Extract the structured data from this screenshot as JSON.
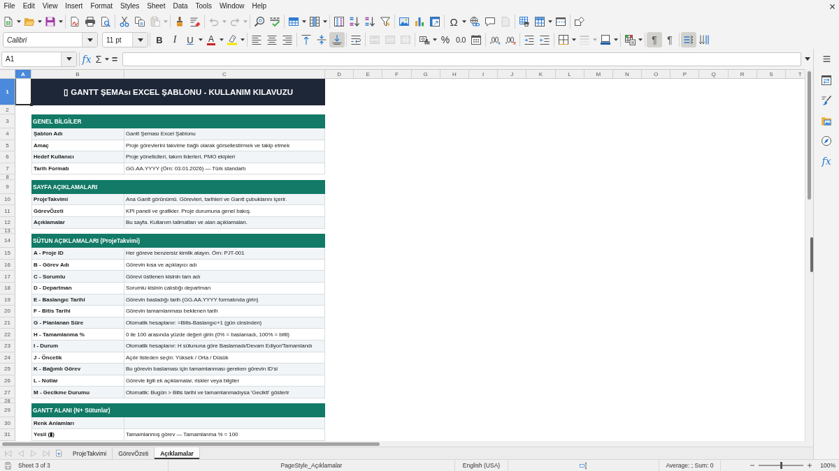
{
  "menu_bar": {
    "items": [
      "File",
      "Edit",
      "View",
      "Insert",
      "Format",
      "Styles",
      "Sheet",
      "Data",
      "Tools",
      "Window",
      "Help"
    ]
  },
  "standard_toolbar": {
    "buttons": [
      {
        "kind": "icon",
        "disabled": false
      },
      {
        "kind": "icon",
        "disabled": false
      },
      {
        "kind": "icon",
        "disabled": false
      },
      {
        "kind": "icon",
        "disabled": false
      },
      {
        "kind": "icon",
        "disabled": false
      },
      {
        "kind": "icon",
        "disabled": false
      },
      {
        "kind": "icon",
        "disabled": false
      },
      {
        "kind": "icon",
        "disabled": false
      },
      {
        "kind": "icon",
        "disabled": true
      },
      {
        "kind": "icon",
        "disabled": false
      },
      {
        "kind": "icon",
        "disabled": false
      },
      {
        "kind": "icon",
        "disabled": true
      },
      {
        "kind": "icon",
        "disabled": true
      },
      {
        "kind": "icon",
        "disabled": false
      },
      {
        "kind": "icon",
        "disabled": false
      },
      {
        "kind": "icon",
        "disabled": false
      },
      {
        "kind": "icon",
        "disabled": false
      },
      {
        "kind": "icon",
        "disabled": false
      },
      {
        "kind": "icon",
        "disabled": false
      },
      {
        "kind": "icon",
        "disabled": false
      },
      {
        "kind": "icon",
        "disabled": false
      },
      {
        "kind": "icon",
        "disabled": false
      },
      {
        "kind": "icon",
        "disabled": false
      },
      {
        "kind": "icon",
        "disabled": false
      },
      {
        "kind": "glyph",
        "glyph": "Ω",
        "disabled": false
      },
      {
        "kind": "icon",
        "disabled": false
      },
      {
        "kind": "icon",
        "disabled": false
      },
      {
        "kind": "icon",
        "disabled": true
      },
      {
        "kind": "icon",
        "disabled": false
      },
      {
        "kind": "icon",
        "disabled": false
      },
      {
        "kind": "icon",
        "disabled": false
      },
      {
        "kind": "icon",
        "disabled": false
      }
    ]
  },
  "formatting_toolbar": {
    "font_name": "Calibri",
    "font_size": "11 pt",
    "buttons": [
      {
        "kind": "glyph",
        "glyph": "B",
        "on": false,
        "disabled": false
      },
      {
        "kind": "glyph",
        "glyph": "I",
        "on": false,
        "disabled": false
      },
      {
        "kind": "glyph",
        "glyph": "U",
        "on": false,
        "disabled": false
      },
      {
        "kind": "glyph",
        "glyph": "A",
        "on": false,
        "disabled": false
      },
      {
        "kind": "icon",
        "on": false,
        "disabled": false
      },
      {
        "kind": "icon",
        "on": false,
        "disabled": false
      },
      {
        "kind": "icon",
        "on": false,
        "disabled": false
      },
      {
        "kind": "icon",
        "on": false,
        "disabled": false
      },
      {
        "kind": "icon",
        "on": false,
        "disabled": false
      },
      {
        "kind": "icon",
        "on": false,
        "disabled": false
      },
      {
        "kind": "icon",
        "on": true,
        "disabled": false
      },
      {
        "kind": "icon",
        "on": false,
        "disabled": false
      },
      {
        "kind": "icon",
        "on": false,
        "disabled": true
      },
      {
        "kind": "icon",
        "on": false,
        "disabled": true
      },
      {
        "kind": "icon",
        "on": false,
        "disabled": true
      },
      {
        "kind": "icon",
        "on": false,
        "disabled": false
      },
      {
        "kind": "glyph",
        "glyph": "%",
        "on": false,
        "disabled": false
      },
      {
        "kind": "glyph",
        "glyph": "0.0",
        "on": false,
        "disabled": false
      },
      {
        "kind": "icon",
        "on": false,
        "disabled": false
      },
      {
        "kind": "icon",
        "on": false,
        "disabled": false
      },
      {
        "kind": "icon",
        "on": false,
        "disabled": false
      },
      {
        "kind": "icon",
        "on": false,
        "disabled": false
      },
      {
        "kind": "icon",
        "on": false,
        "disabled": false
      },
      {
        "kind": "icon",
        "on": false,
        "disabled": false
      },
      {
        "kind": "icon",
        "on": false,
        "disabled": true
      },
      {
        "kind": "icon",
        "on": false,
        "disabled": false
      },
      {
        "kind": "icon",
        "on": false,
        "disabled": false
      },
      {
        "kind": "glyph",
        "glyph": "¶",
        "on": true,
        "disabled": false
      },
      {
        "kind": "glyph",
        "glyph": "¶",
        "on": false,
        "disabled": false
      },
      {
        "kind": "icon",
        "on": true,
        "disabled": false
      },
      {
        "kind": "icon",
        "on": false,
        "disabled": false
      }
    ]
  },
  "formula_bar": {
    "cell_reference": "A1",
    "function_wizard_glyph": "fx",
    "sum_glyph": "Σ",
    "formula_glyph": "="
  },
  "sheet": {
    "columns": [
      {
        "label": "A",
        "selected": true
      },
      {
        "label": "B",
        "selected": false
      },
      {
        "label": "C",
        "selected": false
      },
      {
        "label": "D",
        "selected": false
      },
      {
        "label": "E",
        "selected": false
      },
      {
        "label": "F",
        "selected": false
      },
      {
        "label": "G",
        "selected": false
      },
      {
        "label": "H",
        "selected": false
      },
      {
        "label": "I",
        "selected": false
      },
      {
        "label": "J",
        "selected": false
      },
      {
        "label": "K",
        "selected": false
      },
      {
        "label": "L",
        "selected": false
      },
      {
        "label": "M",
        "selected": false
      },
      {
        "label": "N",
        "selected": false
      },
      {
        "label": "O",
        "selected": false
      },
      {
        "label": "P",
        "selected": false
      },
      {
        "label": "Q",
        "selected": false
      },
      {
        "label": "R",
        "selected": false
      },
      {
        "label": "S",
        "selected": false
      },
      {
        "label": "T",
        "selected": false
      }
    ],
    "rows": [
      {
        "number": "1",
        "selected": true,
        "kind": "title",
        "text": "▯ GANTT ŞEMAsı EXCEL ŞABLONU - KULLANIM KILAVUZU"
      },
      {
        "number": "2",
        "selected": false,
        "kind": "blank"
      },
      {
        "number": "3",
        "selected": false,
        "kind": "section",
        "text": "GENEL BİLGİLER"
      },
      {
        "number": "4",
        "selected": false,
        "kind": "item",
        "label": "Şablon Adı",
        "value": "Gantt Şeması Excel Şablonu"
      },
      {
        "number": "5",
        "selected": false,
        "kind": "item",
        "label": "Amaç",
        "value": "Proje görevlerini takvime bağlı olarak görsellestirmek ve takip etmek"
      },
      {
        "number": "6",
        "selected": false,
        "kind": "item",
        "label": "Hedef Kullanıcı",
        "value": "Proje yöneticileri, takım liderleri, PMO ekipleri"
      },
      {
        "number": "7",
        "selected": false,
        "kind": "item",
        "label": "Tarih Formatı",
        "value": "GG.AA.YYYY (Örn: 03.01.2026) — Türk standartı"
      },
      {
        "number": "8",
        "selected": false,
        "kind": "spacer"
      },
      {
        "number": "9",
        "selected": false,
        "kind": "section",
        "text": "SAYFA AÇIKLAMALARI"
      },
      {
        "number": "10",
        "selected": false,
        "kind": "item",
        "label": "ProjeTakvimi",
        "value": "Ana Gantt görünümü. Görevleri, tarihleri ve Gantt çubuklarını içerir."
      },
      {
        "number": "11",
        "selected": false,
        "kind": "item",
        "label": "GörevÖzeti",
        "value": "KPI paneli ve grafikler. Proje durumuna genel bakış."
      },
      {
        "number": "12",
        "selected": false,
        "kind": "item",
        "label": "Açıklamalar",
        "value": "Bu sayfa. Kullanım talimatları ve alan açıklamaları."
      },
      {
        "number": "13",
        "selected": false,
        "kind": "spacer"
      },
      {
        "number": "14",
        "selected": false,
        "kind": "section",
        "text": "SÜTUN AÇIKLAMALARI (ProjeTakvimi)"
      },
      {
        "number": "15",
        "selected": false,
        "kind": "item",
        "label": "A - Proje ID",
        "value": "Her göreve benzersiz kimlik atayın. Örn: PJT-001"
      },
      {
        "number": "16",
        "selected": false,
        "kind": "item",
        "label": "B - Görev Adı",
        "value": "Görevin kısa ve açıklayıcı adı"
      },
      {
        "number": "17",
        "selected": false,
        "kind": "item",
        "label": "C - Sorumlu",
        "value": "Görevi üstlenen kisinin tam adı"
      },
      {
        "number": "18",
        "selected": false,
        "kind": "item",
        "label": "D - Departman",
        "value": "Sorumlu kisinin calıstığı departman"
      },
      {
        "number": "19",
        "selected": false,
        "kind": "item",
        "label": "E - Baslangıc Tarihi",
        "value": "Görevin basladığı tarih (GG.AA.YYYY formatında girin)"
      },
      {
        "number": "20",
        "selected": false,
        "kind": "item",
        "label": "F - Bitis Tarihi",
        "value": "Görevin tamamlanması beklenen tarih"
      },
      {
        "number": "21",
        "selected": false,
        "kind": "item",
        "label": "G - Planlanan Süre",
        "value": "Otomatik hesaplanır: =Bitis-Baslangıc+1 (gün cinsinden)"
      },
      {
        "number": "22",
        "selected": false,
        "kind": "item",
        "label": "H - Tamamlanma %",
        "value": "0 ile 100 arasında yüzde değeri girin (0% = baslamadı, 100% = bitti)"
      },
      {
        "number": "23",
        "selected": false,
        "kind": "item",
        "label": "I - Durum",
        "value": "Otomatik hesaplanır: H sütununa göre Baslamadı/Devam Ediyor/Tamamlandı"
      },
      {
        "number": "24",
        "selected": false,
        "kind": "item",
        "label": "J - Öncelik",
        "value": "Açılır listeden seçin: Yüksek / Orta / Düsük"
      },
      {
        "number": "25",
        "selected": false,
        "kind": "item",
        "label": "K - Bağımlı Görev",
        "value": "Bu görevin baslaması için tamamlanması gereken görevin ID'si"
      },
      {
        "number": "26",
        "selected": false,
        "kind": "item",
        "label": "L - Notlar",
        "value": "Görevle ilgili ek açıklamalar, riskler veya bilgiler"
      },
      {
        "number": "27",
        "selected": false,
        "kind": "item",
        "label": "M - Gecikme Durumu",
        "value": "Otomatik: Bugün > Bitis tarihi ve tamamlanmadıysa 'Gecikti' gösterir"
      },
      {
        "number": "28",
        "selected": false,
        "kind": "spacer"
      },
      {
        "number": "29",
        "selected": false,
        "kind": "section",
        "text": "GANTT ALANI (N+ Sütunlar)"
      },
      {
        "number": "30",
        "selected": false,
        "kind": "item",
        "label": "Renk Anlamları"
      },
      {
        "number": "31",
        "selected": false,
        "kind": "item",
        "label": "Yesil (▮)",
        "value": "Tamamlanmış görev — Tamamlanma % = 100"
      }
    ]
  },
  "sidebar": {
    "buttons": [
      {
        "kind": "icon",
        "selected": false
      },
      {
        "kind": "icon",
        "selected": false
      },
      {
        "kind": "icon",
        "selected": false
      },
      {
        "kind": "icon",
        "selected": false
      },
      {
        "kind": "glyph",
        "glyph": "fx",
        "selected": false
      }
    ]
  },
  "sheet_tabs": {
    "navigation_buttons": [
      {
        "disabled": true
      },
      {
        "disabled": true
      },
      {
        "disabled": true
      },
      {
        "disabled": true
      }
    ],
    "tabs": [
      {
        "label": "ProjeTakvimi",
        "selected": false
      },
      {
        "label": "GörevÖzeti",
        "selected": false
      },
      {
        "label": "Açıklamalar",
        "selected": true
      }
    ]
  },
  "status_bar": {
    "sheet_position": "Sheet 3 of 3",
    "page_style": "PageStyle_Açıklamalar",
    "language": "English (USA)",
    "selection_summary": "Average: ; Sum: 0",
    "zoom": {
      "level": 0.5,
      "reading": "100%"
    }
  }
}
